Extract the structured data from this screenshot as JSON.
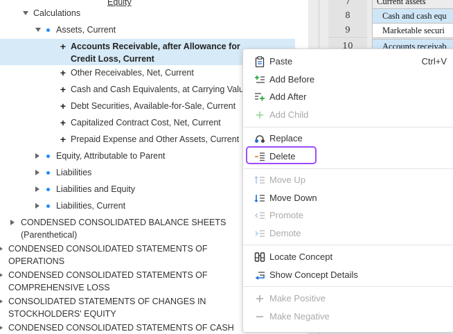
{
  "tree": {
    "top_partial": "Equity",
    "calculations": "Calculations",
    "assets_current": "Assets, Current",
    "selected_line1": "Accounts Receivable, after Allowance for",
    "selected_line2": "Credit Loss, Current",
    "children": [
      "Other Receivables, Net, Current",
      "Cash and Cash Equivalents, at Carrying Value",
      "Debt Securities, Available-for-Sale, Current",
      "Capitalized Contract Cost, Net, Current",
      "Prepaid Expense and Other Assets, Current"
    ],
    "siblings": [
      "Equity, Attributable to Parent",
      "Liabilities",
      "Liabilities and Equity",
      "Liabilities, Current"
    ],
    "sections": [
      {
        "line1": "CONDENSED CONSOLIDATED BALANCE SHEETS",
        "line2": "(Parenthetical)"
      },
      {
        "line1": "CONDENSED CONSOLIDATED STATEMENTS OF",
        "line2": "OPERATIONS"
      },
      {
        "line1": "CONDENSED CONSOLIDATED STATEMENTS OF",
        "line2": "COMPREHENSIVE LOSS"
      },
      {
        "line1": "CONSOLIDATED STATEMENTS OF CHANGES IN",
        "line2": "STOCKHOLDERS' EQUITY"
      },
      {
        "line1": "CONDENSED CONSOLIDATED STATEMENTS OF CASH",
        "line2": ""
      }
    ]
  },
  "grid": {
    "rows": [
      {
        "num": "7",
        "text": "Current assets"
      },
      {
        "num": "8",
        "text": "Cash and cash equ"
      },
      {
        "num": "9",
        "text": "Marketable securi"
      },
      {
        "num": "10",
        "text": "Accounts receivab"
      }
    ]
  },
  "menu": {
    "paste": "Paste",
    "paste_shortcut": "Ctrl+V",
    "add_before": "Add Before",
    "add_after": "Add After",
    "add_child": "Add Child",
    "replace": "Replace",
    "delete": "Delete",
    "move_up": "Move Up",
    "move_down": "Move Down",
    "promote": "Promote",
    "demote": "Demote",
    "locate_concept": "Locate Concept",
    "show_concept_details": "Show Concept Details",
    "make_positive": "Make Positive",
    "make_negative": "Make Negative"
  },
  "colors": {
    "selection": "#d6eaf8",
    "dot": "#1a8cff",
    "highlight_border": "#9b4dff",
    "icon_green": "#2eaa3c"
  }
}
